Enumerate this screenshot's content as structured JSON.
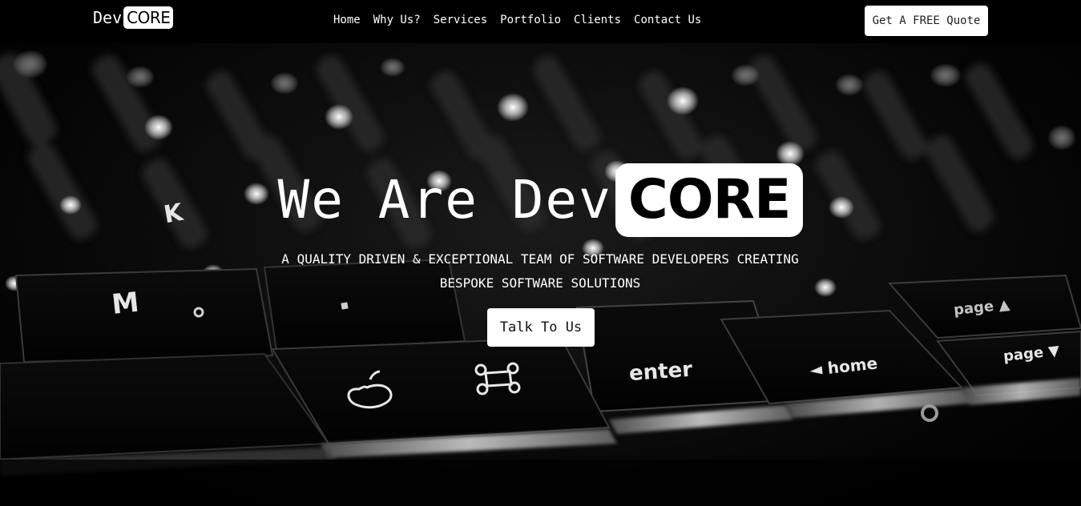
{
  "brand": {
    "prefix": "Dev",
    "badge": "CORE"
  },
  "nav": {
    "items": [
      {
        "label": "Home"
      },
      {
        "label": "Why Us?"
      },
      {
        "label": "Services"
      },
      {
        "label": "Portfolio"
      },
      {
        "label": "Clients"
      },
      {
        "label": "Contact Us"
      }
    ],
    "cta_label": "Get A FREE Quote"
  },
  "hero": {
    "title_prefix": "We Are Dev",
    "title_badge": "CORE",
    "subtitle_line1": "A QUALITY DRIVEN & EXCEPTIONAL TEAM OF SOFTWARE DEVELOPERS CREATING",
    "subtitle_line2": "BESPOKE SOFTWARE SOLUTIONS",
    "cta_label": "Talk To Us",
    "background_image": "keyboard-photo",
    "keycaps": {
      "m": "M",
      "k": "K",
      "enter": "enter",
      "home": "◄ home",
      "page_up": "page ▲",
      "page_down": "page ▼"
    }
  },
  "colors": {
    "background": "#000000",
    "text": "#ffffff",
    "button_bg": "#ffffff",
    "button_text": "#111111"
  }
}
